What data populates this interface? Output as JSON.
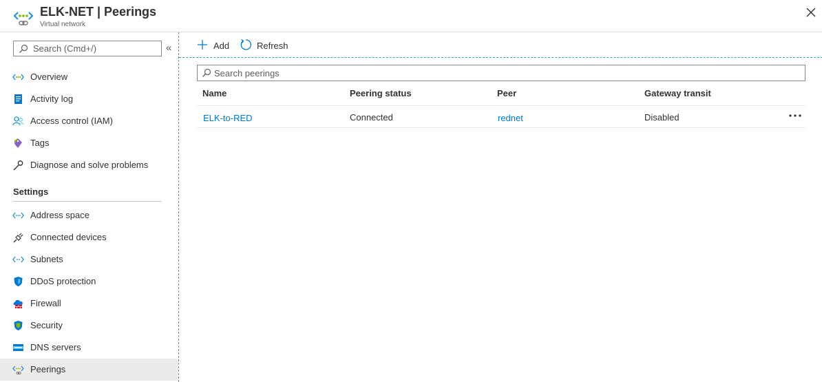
{
  "header": {
    "title": "ELK-NET | Peerings",
    "subtitle": "Virtual network",
    "icon": "virtual-network-icon",
    "close_icon": "close-icon"
  },
  "sidebar": {
    "search_placeholder": "Search (Cmd+/)",
    "collapse_label": "«",
    "items": [
      {
        "label": "Overview",
        "icon": "virtual-network-icon"
      },
      {
        "label": "Activity log",
        "icon": "activity-log-icon"
      },
      {
        "label": "Access control (IAM)",
        "icon": "people-icon"
      },
      {
        "label": "Tags",
        "icon": "tag-icon"
      },
      {
        "label": "Diagnose and solve problems",
        "icon": "wrench-icon"
      }
    ],
    "section_title": "Settings",
    "settings_items": [
      {
        "label": "Address space",
        "icon": "address-space-icon"
      },
      {
        "label": "Connected devices",
        "icon": "plug-icon"
      },
      {
        "label": "Subnets",
        "icon": "subnet-icon"
      },
      {
        "label": "DDoS protection",
        "icon": "shield-icon"
      },
      {
        "label": "Firewall",
        "icon": "firewall-icon"
      },
      {
        "label": "Security",
        "icon": "security-shield-icon"
      },
      {
        "label": "DNS servers",
        "icon": "dns-icon"
      },
      {
        "label": "Peerings",
        "icon": "peering-icon",
        "active": true
      }
    ]
  },
  "toolbar": {
    "add_label": "Add",
    "refresh_label": "Refresh"
  },
  "peerings": {
    "search_placeholder": "Search peerings",
    "columns": [
      "Name",
      "Peering status",
      "Peer",
      "Gateway transit"
    ],
    "rows": [
      {
        "name": "ELK-to-RED",
        "status": "Connected",
        "peer": "rednet",
        "gateway_transit": "Disabled"
      }
    ]
  },
  "colors": {
    "link": "#0078d4",
    "active_bg": "#edebe9",
    "accent_dashed": "#3aa0c8"
  }
}
